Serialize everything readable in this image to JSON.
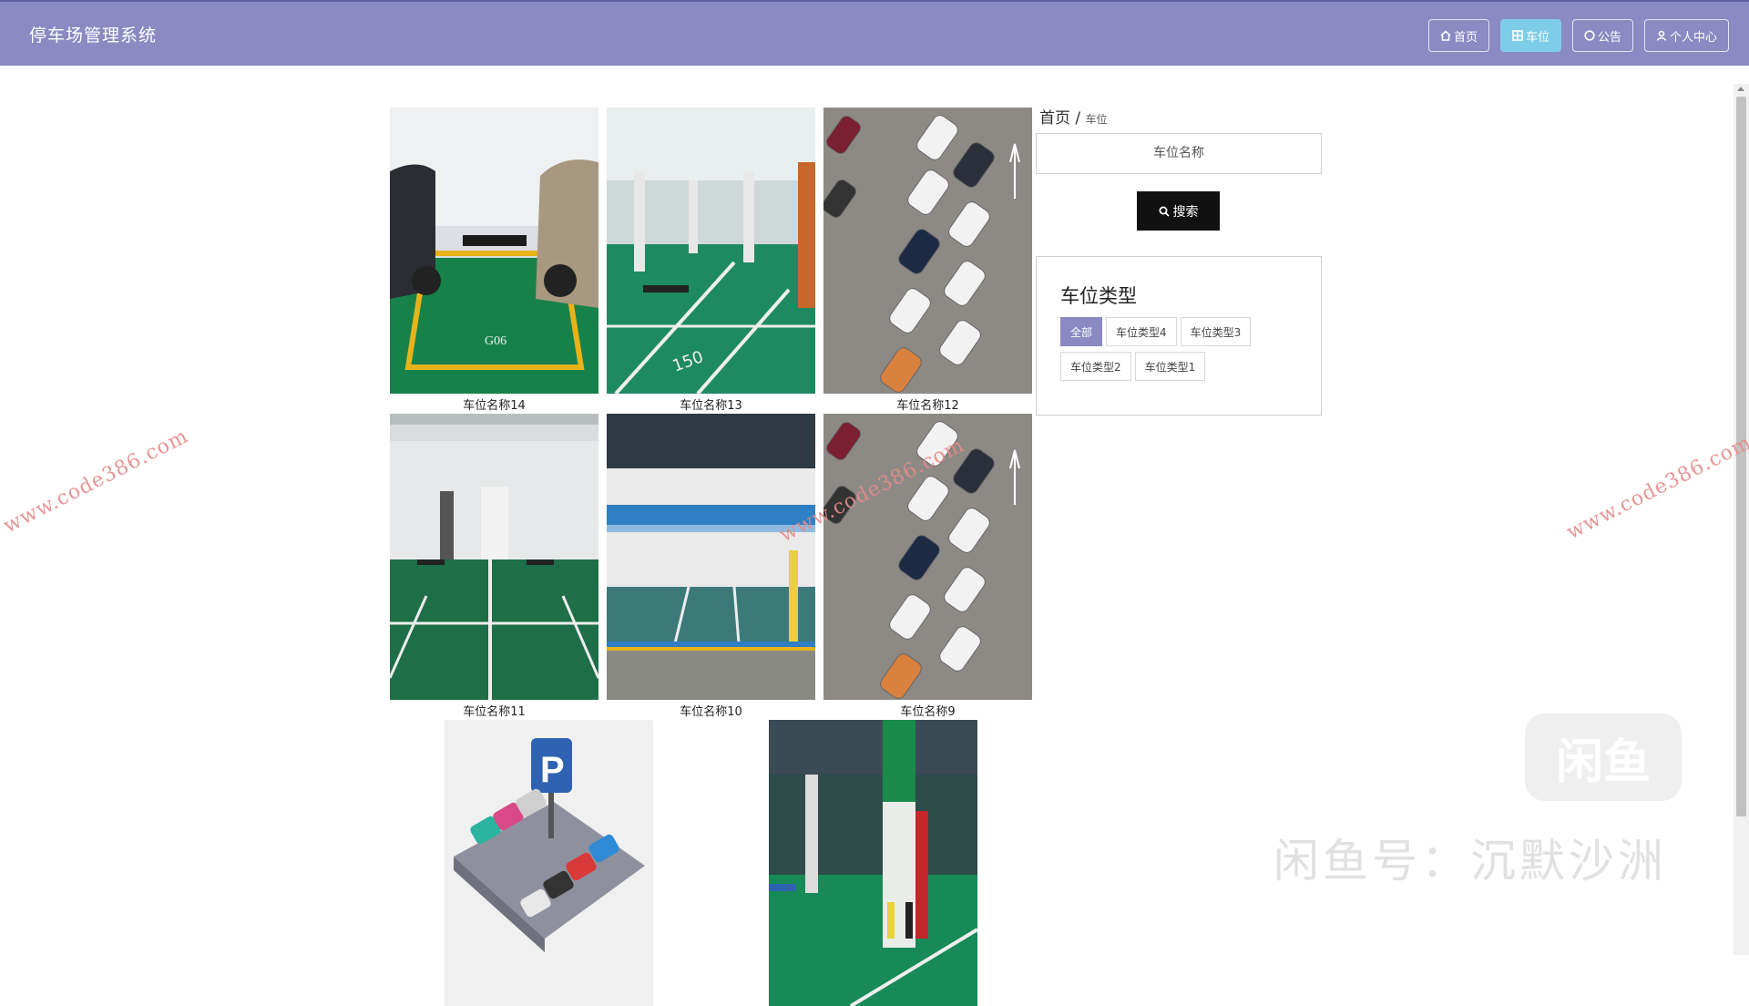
{
  "header": {
    "brand": "停车场管理系统",
    "nav": [
      {
        "label": "首页",
        "icon": "home-icon",
        "active": false
      },
      {
        "label": "车位",
        "icon": "grid-icon",
        "active": true
      },
      {
        "label": "公告",
        "icon": "chat-icon",
        "active": false
      },
      {
        "label": "个人中心",
        "icon": "user-icon",
        "active": false
      }
    ]
  },
  "breadcrumb": {
    "home": "首页",
    "sep": "/",
    "current": "车位"
  },
  "search": {
    "placeholder": "车位名称",
    "button": "搜索"
  },
  "types": {
    "title": "车位类型",
    "tags": [
      "全部",
      "车位类型4",
      "车位类型3",
      "车位类型2",
      "车位类型1"
    ],
    "active_index": 0
  },
  "items": [
    {
      "name": "车位名称14",
      "image": "green parking space with yellow border G06"
    },
    {
      "name": "车位名称13",
      "image": "underground parking lot 150"
    },
    {
      "name": "车位名称12",
      "image": "aerial view diagonal parked cars"
    },
    {
      "name": "车位名称11",
      "image": "white corridor underground parking"
    },
    {
      "name": "车位名称10",
      "image": "blue striped underground parking space"
    },
    {
      "name": "车位名称9",
      "image": "aerial view diagonal parked cars"
    },
    {
      "name": "",
      "image": "isometric parking P sign cars"
    },
    {
      "name": "",
      "image": "underground garage green floor pillars"
    }
  ],
  "watermarks": {
    "site": "www.code386.com",
    "app_logo": "闲鱼",
    "app_id": "闲鱼号：沉默沙洲"
  }
}
